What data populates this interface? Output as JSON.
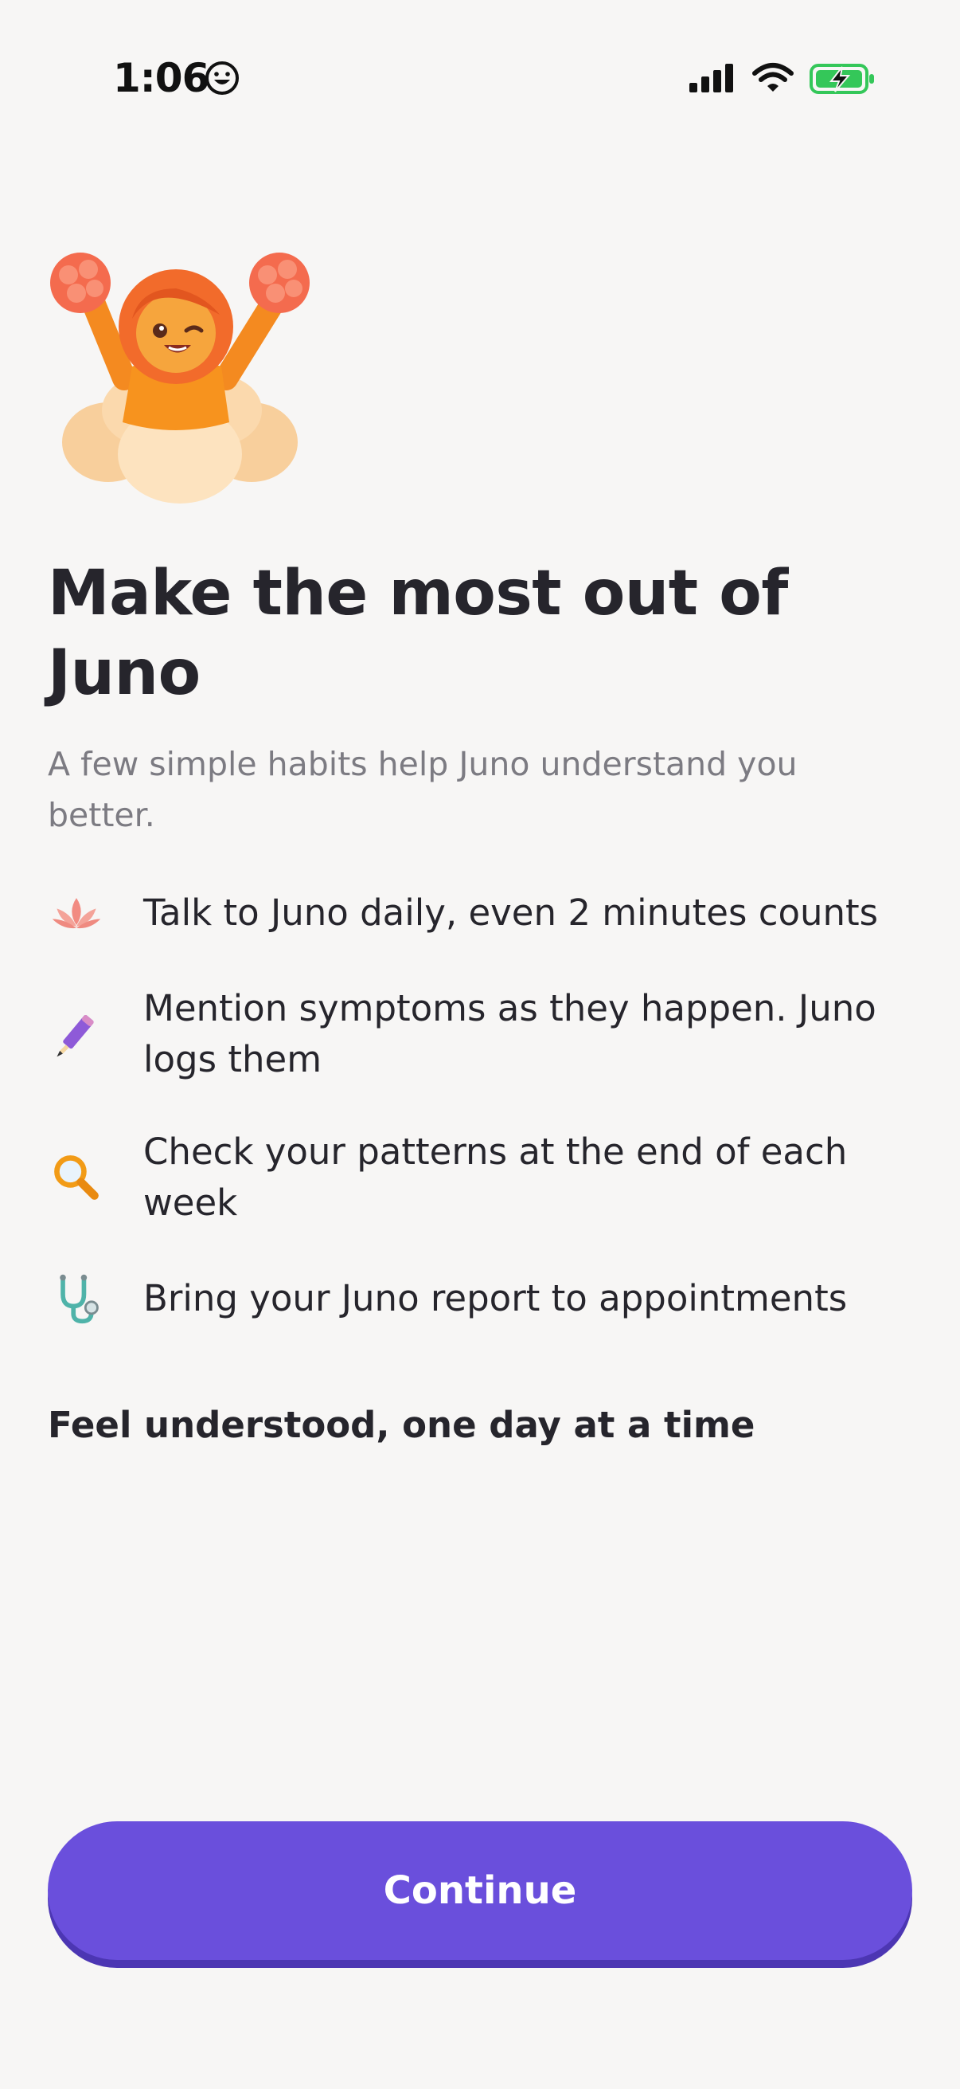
{
  "status_bar": {
    "time": "1:06",
    "icons": [
      "smiley-icon",
      "cellular-signal-icon",
      "wifi-icon",
      "battery-charging-icon"
    ]
  },
  "hero": {
    "image": "cheerleader-on-cloud-illustration"
  },
  "title": "Make the most out of Juno",
  "subtitle": "A few simple habits help Juno understand you better.",
  "habits": [
    {
      "icon": "lotus-icon",
      "text": "Talk to Juno daily, even 2 minutes counts"
    },
    {
      "icon": "pencil-icon",
      "text": "Mention symptoms as they happen. Juno logs them"
    },
    {
      "icon": "magnifying-glass-icon",
      "text": "Check your patterns at the end of each week"
    },
    {
      "icon": "stethoscope-icon",
      "text": "Bring your Juno report to appointments"
    }
  ],
  "tagline": "Feel understood, one day at a time",
  "continue_button": {
    "label": "Continue"
  },
  "colors": {
    "background": "#f7f6f5",
    "primary": "#6a4fdc",
    "primary_shadow": "#4c36b3",
    "text": "#26252c",
    "muted_text": "#7c7b82",
    "battery_green": "#34c759"
  }
}
